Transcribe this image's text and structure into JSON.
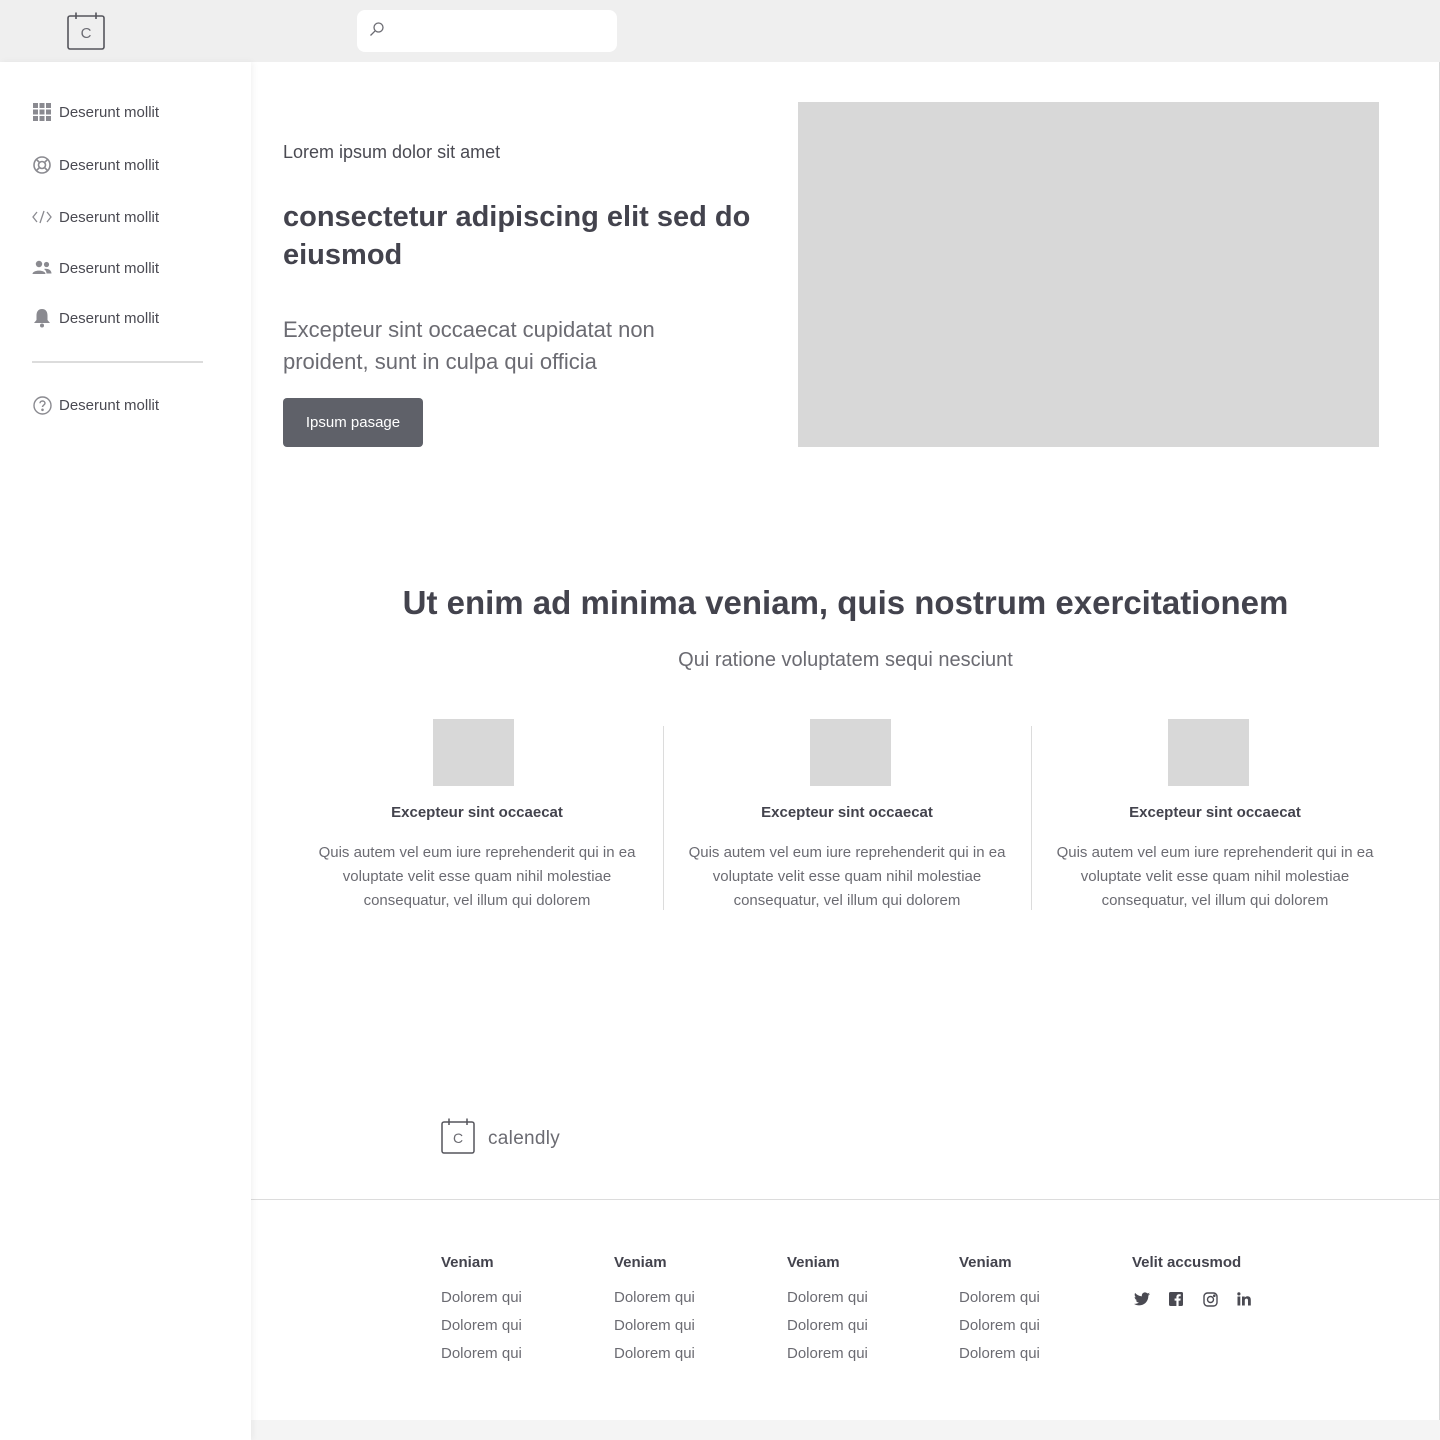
{
  "header": {
    "logo_icon": "calendar-logo-icon",
    "logo_letter": "C",
    "search": {
      "placeholder": "",
      "value": "",
      "icon": "search-icon"
    }
  },
  "sidebar": {
    "items": [
      {
        "label": "Deserunt mollit",
        "icon": "grid-icon"
      },
      {
        "label": "Deserunt mollit",
        "icon": "lifebuoy-icon"
      },
      {
        "label": "Deserunt mollit",
        "icon": "code-icon"
      },
      {
        "label": "Deserunt mollit",
        "icon": "users-icon"
      },
      {
        "label": "Deserunt mollit",
        "icon": "bell-icon"
      }
    ],
    "help_item": {
      "label": "Deserunt mollit",
      "icon": "question-circle-icon"
    }
  },
  "hero": {
    "kicker": "Lorem ipsum dolor sit amet",
    "title": "consectetur adipiscing elit sed do eiusmod",
    "body": "Excepteur sint occaecat cupidatat non proident, sunt in culpa qui officia",
    "button_label": "Ipsum pasage"
  },
  "features_section": {
    "title": "Ut enim ad minima veniam, quis nostrum exercitationem",
    "subtitle": "Qui ratione voluptatem sequi nesciunt",
    "items": [
      {
        "title": "Excepteur sint occaecat",
        "body": "Quis autem vel eum iure reprehenderit qui in ea voluptate velit esse quam nihil molestiae consequatur, vel illum qui dolorem"
      },
      {
        "title": "Excepteur sint occaecat",
        "body": "Quis autem vel eum iure reprehenderit qui in ea voluptate velit esse quam nihil molestiae consequatur, vel illum qui dolorem"
      },
      {
        "title": "Excepteur sint occaecat",
        "body": "Quis autem vel eum iure reprehenderit qui in ea voluptate velit esse quam nihil molestiae consequatur, vel illum qui dolorem"
      }
    ]
  },
  "footer": {
    "brand_letter": "C",
    "brand_name": "calendly",
    "columns": [
      {
        "heading": "Veniam",
        "links": [
          "Dolorem qui",
          "Dolorem qui",
          "Dolorem qui"
        ]
      },
      {
        "heading": "Veniam",
        "links": [
          "Dolorem qui",
          "Dolorem qui",
          "Dolorem qui"
        ]
      },
      {
        "heading": "Veniam",
        "links": [
          "Dolorem qui",
          "Dolorem qui",
          "Dolorem qui"
        ]
      },
      {
        "heading": "Veniam",
        "links": [
          "Dolorem qui",
          "Dolorem qui",
          "Dolorem qui"
        ]
      }
    ],
    "social": {
      "heading": "Velit accusmod",
      "icons": [
        "twitter-icon",
        "facebook-icon",
        "instagram-icon",
        "linkedin-icon"
      ]
    }
  },
  "colors": {
    "topbar_bg": "#efefef",
    "button_bg": "#5f6169",
    "placeholder_gray": "#d8d8d8",
    "heading_text": "#43434d",
    "body_text": "#6b6b72"
  }
}
